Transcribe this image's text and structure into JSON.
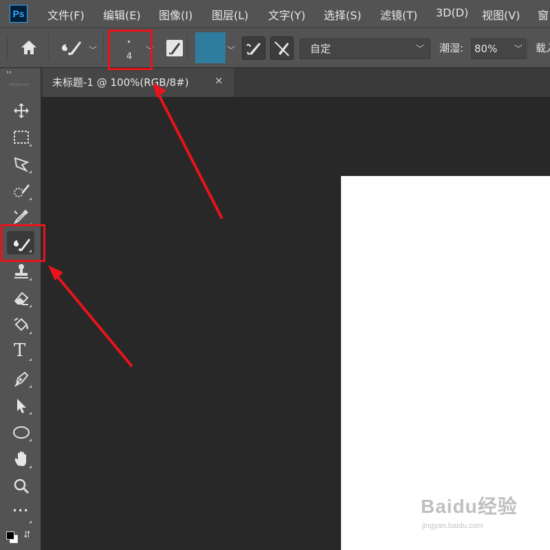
{
  "app": {
    "logo_text": "Ps"
  },
  "menu": [
    "文件(F)",
    "编辑(E)",
    "图像(I)",
    "图层(L)",
    "文字(Y)",
    "选择(S)",
    "滤镜(T)",
    "3D(D)",
    "视图(V)",
    "窗"
  ],
  "options_bar": {
    "brush_size": "4",
    "brush_color": "#2e7d9f",
    "mix_preset": "自定",
    "wet_label": "潮湿:",
    "wet_value": "80%",
    "load_label": "载入"
  },
  "document": {
    "tab_title": "未标题-1 @ 100%(RGB/8#)",
    "close_glyph": "×"
  },
  "toolbar": {
    "collapse_glyph": "››",
    "tools": [
      "move-tool",
      "marquee-tool",
      "lasso-tool",
      "quick-selection-tool",
      "eyedropper-tool",
      "mixer-brush-tool",
      "clone-stamp-tool",
      "eraser-tool",
      "paint-bucket-tool",
      "type-tool",
      "pen-tool",
      "path-selection-tool",
      "ellipse-tool",
      "hand-tool",
      "zoom-tool",
      "more-tools"
    ],
    "more_glyph": "•••",
    "type_glyph": "T"
  },
  "annotation_color": "#e8141b",
  "watermark": {
    "brand": "Baidu经验",
    "url": "jingyan.baidu.com"
  }
}
